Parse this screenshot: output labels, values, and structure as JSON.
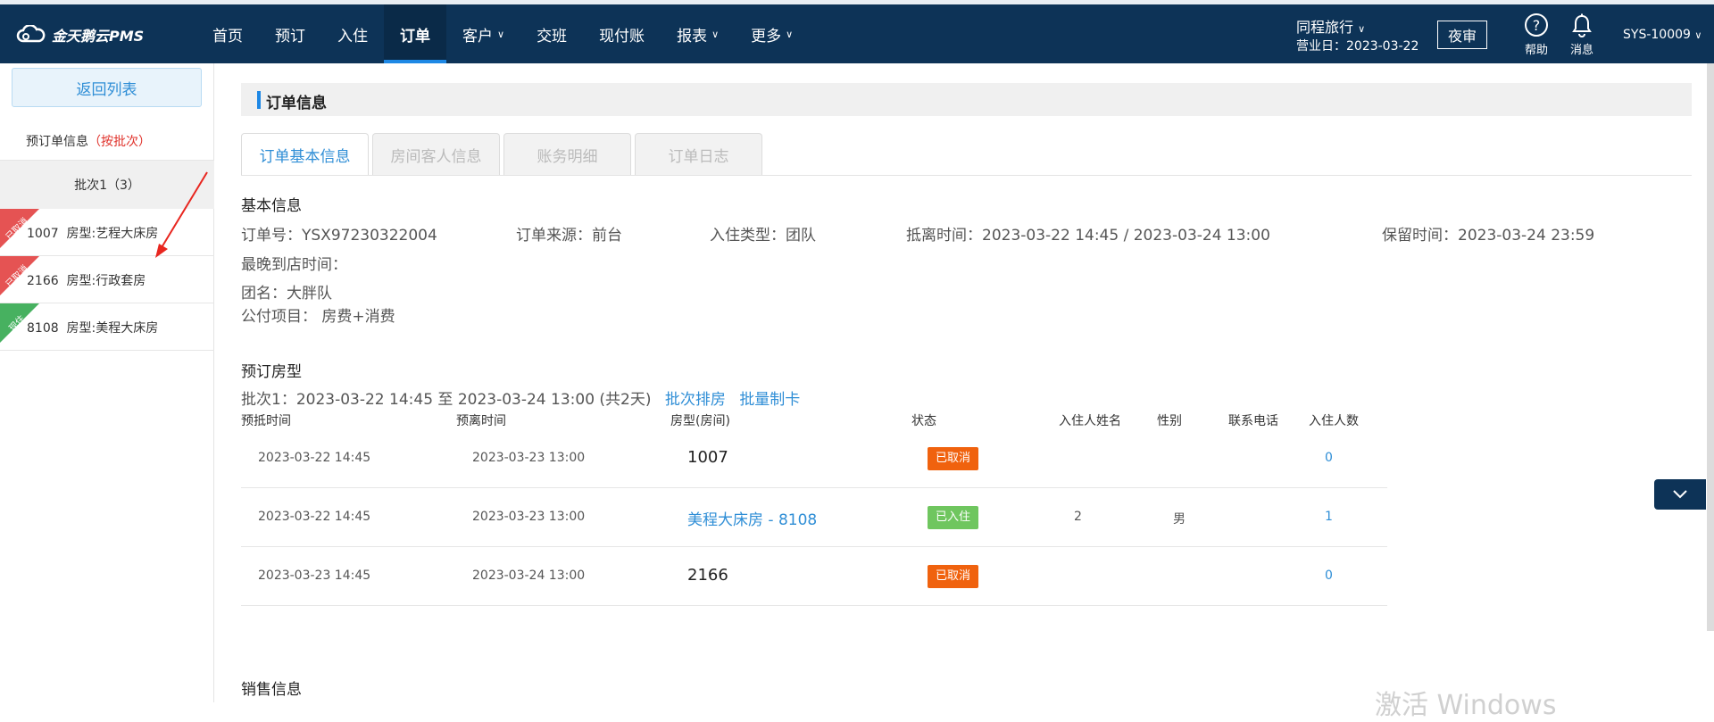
{
  "app": {
    "logo_text": "金天鹅云PMS"
  },
  "nav": {
    "items": [
      {
        "label": "首页",
        "dropdown": false,
        "active": false
      },
      {
        "label": "预订",
        "dropdown": false,
        "active": false
      },
      {
        "label": "入住",
        "dropdown": false,
        "active": false
      },
      {
        "label": "订单",
        "dropdown": false,
        "active": true
      },
      {
        "label": "客户",
        "dropdown": true,
        "active": false
      },
      {
        "label": "交班",
        "dropdown": false,
        "active": false
      },
      {
        "label": "现付账",
        "dropdown": false,
        "active": false
      },
      {
        "label": "报表",
        "dropdown": true,
        "active": false
      },
      {
        "label": "更多",
        "dropdown": true,
        "active": false
      }
    ],
    "hotel_name": "同程旅行",
    "business_day": "营业日：2023-03-22",
    "night_audit": "夜审",
    "help": "帮助",
    "message": "消息",
    "user": "SYS-10009"
  },
  "sidebar": {
    "back_label": "返回列表",
    "pre_info": "预订单信息",
    "pre_info_mode": "（按批次）",
    "batch_label": "批次1（3）",
    "rooms": [
      {
        "ribbon": "已取消",
        "ribbon_color": "#e55353",
        "text": "1007  房型:艺程大床房"
      },
      {
        "ribbon": "已取消",
        "ribbon_color": "#e55353",
        "text": "2166  房型:行政套房"
      },
      {
        "ribbon": "现住",
        "ribbon_color": "#47b160",
        "text": "8108  房型:美程大床房"
      }
    ]
  },
  "main": {
    "section_title": "订单信息",
    "tabs": [
      "订单基本信息",
      "房间客人信息",
      "账务明细",
      "订单日志"
    ],
    "basic": {
      "title": "基本信息",
      "order_no": "订单号：YSX97230322004",
      "source": "订单来源：前台",
      "checkin_type": "入住类型：团队",
      "arrive_leave": "抵离时间：2023-03-22 14:45 / 2023-03-24 13:00",
      "hold_time": "保留时间：2023-03-24 23:59",
      "latest_arrival": "最晚到店时间：",
      "group_name": "团名：大胖队",
      "public_items": "公付项目： 房费+消费"
    },
    "booking": {
      "title": "预订房型",
      "batch_line": "批次1：2023-03-22 14:45 至 2023-03-24 13:00 (共2天)",
      "batch_assign": "批次排房",
      "batch_card": "批量制卡",
      "headers": [
        "预抵时间",
        "预离时间",
        "房型(房间)",
        "状态",
        "入住人姓名",
        "性别",
        "联系电话",
        "入住人数"
      ],
      "rows": [
        {
          "arrive": "2023-03-22 14:45",
          "leave": "2023-03-23 13:00",
          "room": "1007",
          "room_link": false,
          "status": "已取消",
          "status_type": "cancel",
          "guest": "",
          "gender": "",
          "phone": "",
          "count": "0"
        },
        {
          "arrive": "2023-03-22 14:45",
          "leave": "2023-03-23 13:00",
          "room": "美程大床房 - 8108",
          "room_link": true,
          "status": "已入住",
          "status_type": "in",
          "guest": "2",
          "gender": "男",
          "phone": "",
          "count": "1"
        },
        {
          "arrive": "2023-03-23 14:45",
          "leave": "2023-03-24 13:00",
          "room": "2166",
          "room_link": false,
          "status": "已取消",
          "status_type": "cancel",
          "guest": "",
          "gender": "",
          "phone": "",
          "count": "0"
        }
      ]
    },
    "sales_title": "销售信息"
  },
  "watermark": "激活 Windows"
}
